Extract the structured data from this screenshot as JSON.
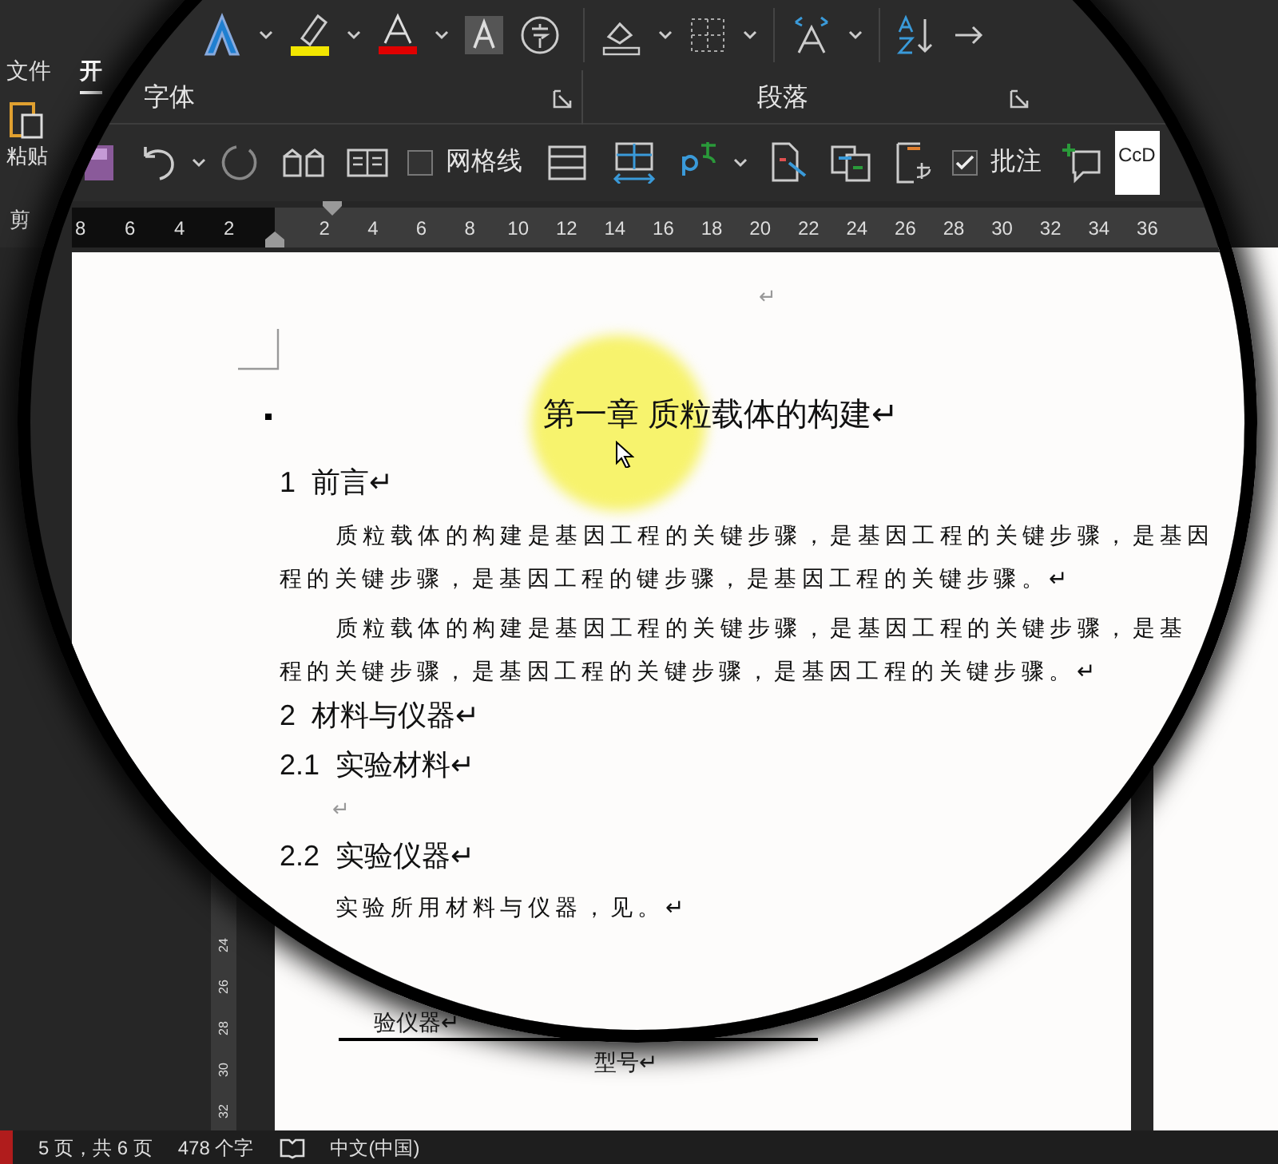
{
  "ribbon_tabs": [
    {
      "label": "文件",
      "selected": false
    },
    {
      "label": "开",
      "selected": true
    }
  ],
  "clipboard": {
    "paste_label": "粘贴",
    "group_label": "剪"
  },
  "font_group": {
    "label": "字体"
  },
  "paragraph_group": {
    "label": "段落"
  },
  "quick_toolbar": {
    "gridlines": {
      "label": "网格线",
      "checked": false
    },
    "comments": {
      "label": "批注",
      "checked": true
    }
  },
  "style_gallery": {
    "preview": "CcD"
  },
  "ruler": {
    "left_ticks": [
      "8",
      "6",
      "4",
      "2"
    ],
    "ticks": [
      "2",
      "4",
      "6",
      "8",
      "10",
      "12",
      "14",
      "16",
      "18",
      "20",
      "22",
      "24",
      "26",
      "28",
      "30",
      "32",
      "34",
      "36"
    ]
  },
  "document": {
    "blocks": [
      {
        "kind": "empty",
        "text": "↵"
      },
      {
        "kind": "title",
        "text": "第一章 质粒载体的构建↵"
      },
      {
        "kind": "heading",
        "text": "1  前言↵"
      },
      {
        "kind": "paragraph",
        "lines": [
          "质粒载体的构建是基因工程的关键步骤，是基因工程的关键步骤，是基因",
          "程的关键步骤，是基因工程的键步骤，是基因工程的关键步骤。↵"
        ]
      },
      {
        "kind": "paragraph",
        "lines": [
          "质粒载体的构建是基因工程的关键步骤，是基因工程的关键步骤，是基",
          "程的关键步骤，是基因工程的关键步骤，是基因工程的关键步骤。↵"
        ]
      },
      {
        "kind": "heading",
        "text": "2  材料与仪器↵"
      },
      {
        "kind": "heading",
        "text": "2.1  实验材料↵"
      },
      {
        "kind": "empty",
        "text": "↵"
      },
      {
        "kind": "heading",
        "text": "2.2  实验仪器↵"
      },
      {
        "kind": "body",
        "text": "实验所用材料与仪器，见。↵"
      }
    ]
  },
  "page_below": {
    "caption": "验仪器↵",
    "table_header": "型号↵"
  },
  "vertical_ruler": [
    "24",
    "26",
    "28",
    "30",
    "32"
  ],
  "status_bar": {
    "page": "5 页，共 6 页",
    "words": "478 个字",
    "language": "中文(中国)"
  }
}
